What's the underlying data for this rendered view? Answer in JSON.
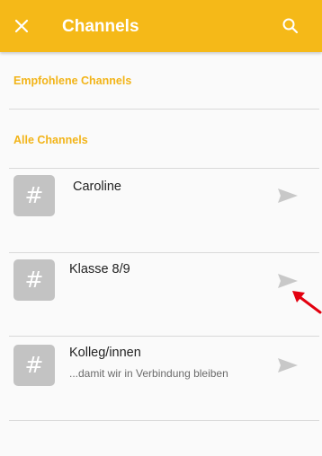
{
  "appbar": {
    "title": "Channels",
    "close_icon": "close-icon",
    "search_icon": "search-icon",
    "color": "#f5b918"
  },
  "sections": {
    "recommended": "Empfohlene Channels",
    "all": "Alle Channels"
  },
  "channels": [
    {
      "icon": "#",
      "name": "Caroline",
      "description": ""
    },
    {
      "icon": "#",
      "name": "Klasse 8/9",
      "description": ""
    },
    {
      "icon": "#",
      "name": "Kolleg/innen",
      "description": "...damit wir in Verbindung bleiben"
    }
  ],
  "colors": {
    "accent": "#f2b418",
    "avatar": "#c3c3c3",
    "send_icon": "#c8c8c8",
    "annotation_arrow": "#e3000f"
  }
}
